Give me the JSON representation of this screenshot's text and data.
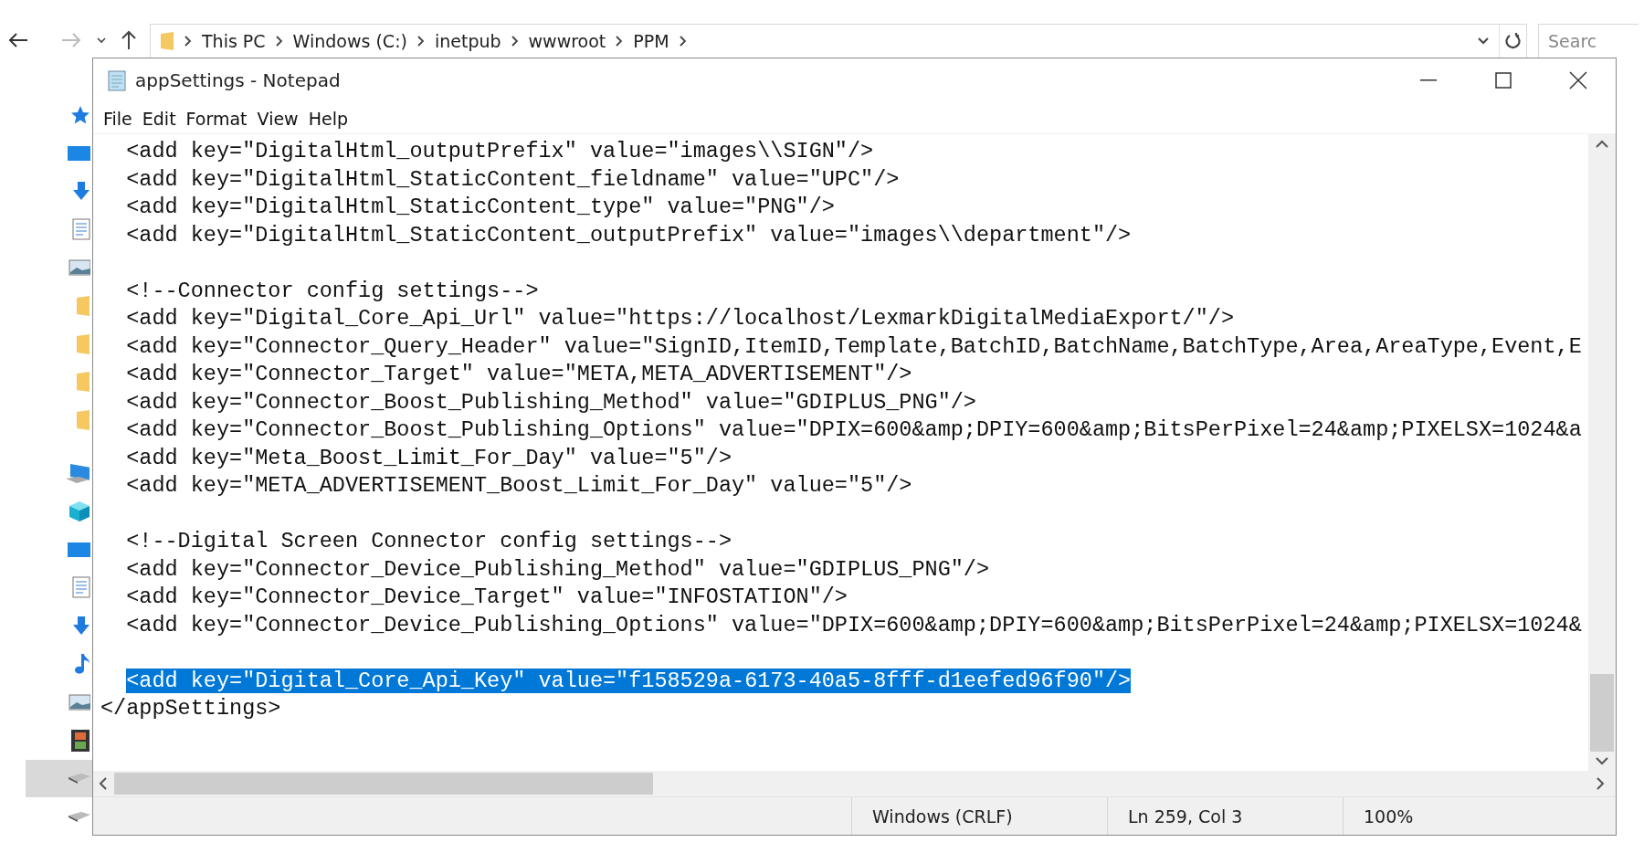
{
  "explorer": {
    "breadcrumbs": [
      "This PC",
      "Windows (C:)",
      "inetpub",
      "wwwroot",
      "PPM"
    ],
    "search": {
      "placeholder": "Searc"
    },
    "nav_items": [
      {
        "kind": "star",
        "selected": false
      },
      {
        "kind": "monitor",
        "selected": false
      },
      {
        "kind": "download",
        "selected": false
      },
      {
        "kind": "document",
        "selected": false
      },
      {
        "kind": "picture",
        "selected": false
      },
      {
        "kind": "folder",
        "selected": false
      },
      {
        "kind": "folder",
        "selected": false
      },
      {
        "kind": "folder",
        "selected": false
      },
      {
        "kind": "folder",
        "selected": false
      },
      {
        "kind": "pc",
        "selected": false
      },
      {
        "kind": "cube",
        "selected": false
      },
      {
        "kind": "monitor",
        "selected": false
      },
      {
        "kind": "document",
        "selected": false
      },
      {
        "kind": "download",
        "selected": false
      },
      {
        "kind": "music",
        "selected": false
      },
      {
        "kind": "picture",
        "selected": false
      },
      {
        "kind": "film",
        "selected": false
      },
      {
        "kind": "drive",
        "selected": true
      },
      {
        "kind": "drive",
        "selected": false
      }
    ]
  },
  "notepad": {
    "title": "appSettings - Notepad",
    "menu": [
      "File",
      "Edit",
      "Format",
      "View",
      "Help"
    ],
    "blocks": [
      {
        "lines": [
          {
            "text": "  <add key=\"DigitalHtml_outputPrefix\" value=\"images\\\\SIGN\"/>",
            "selected": false
          },
          {
            "text": "  <add key=\"DigitalHtml_StaticContent_fieldname\" value=\"UPC\"/>",
            "selected": false
          },
          {
            "text": "  <add key=\"DigitalHtml_StaticContent_type\" value=\"PNG\"/>",
            "selected": false
          },
          {
            "text": "  <add key=\"DigitalHtml_StaticContent_outputPrefix\" value=\"images\\\\department\"/>",
            "selected": false
          }
        ]
      },
      {
        "lines": [
          {
            "text": "  <!--Connector config settings-->",
            "selected": false
          },
          {
            "text": "  <add key=\"Digital_Core_Api_Url\" value=\"https://localhost/LexmarkDigitalMediaExport/\"/>",
            "selected": false
          },
          {
            "text": "  <add key=\"Connector_Query_Header\" value=\"SignID,ItemID,Template,BatchID,BatchName,BatchType,Area,AreaType,Event,E",
            "selected": false
          },
          {
            "text": "  <add key=\"Connector_Target\" value=\"META,META_ADVERTISEMENT\"/>",
            "selected": false
          },
          {
            "text": "  <add key=\"Connector_Boost_Publishing_Method\" value=\"GDIPLUS_PNG\"/>",
            "selected": false
          },
          {
            "text": "  <add key=\"Connector_Boost_Publishing_Options\" value=\"DPIX=600&amp;DPIY=600&amp;BitsPerPixel=24&amp;PIXELSX=1024&a",
            "selected": false
          },
          {
            "text": "  <add key=\"Meta_Boost_Limit_For_Day\" value=\"5\"/>",
            "selected": false
          },
          {
            "text": "  <add key=\"META_ADVERTISEMENT_Boost_Limit_For_Day\" value=\"5\"/>",
            "selected": false
          }
        ]
      },
      {
        "lines": [
          {
            "text": "  <!--Digital Screen Connector config settings-->",
            "selected": false
          },
          {
            "text": "  <add key=\"Connector_Device_Publishing_Method\" value=\"GDIPLUS_PNG\"/>",
            "selected": false
          },
          {
            "text": "  <add key=\"Connector_Device_Target\" value=\"INFOSTATION\"/>",
            "selected": false
          },
          {
            "text": "  <add key=\"Connector_Device_Publishing_Options\" value=\"DPIX=600&amp;DPIY=600&amp;BitsPerPixel=24&amp;PIXELSX=1024&",
            "selected": false
          }
        ]
      },
      {
        "lines": [
          {
            "text": "  <add key=\"Digital_Core_Api_Key\" value=\"f158529a-6173-40a5-8fff-d1eefed96f90\"/>",
            "selected": true
          },
          {
            "text": "</appSettings>",
            "selected": false
          }
        ]
      }
    ],
    "status": {
      "line_ending": "Windows (CRLF)",
      "position": "Ln 259, Col 3",
      "zoom": "100%"
    }
  }
}
